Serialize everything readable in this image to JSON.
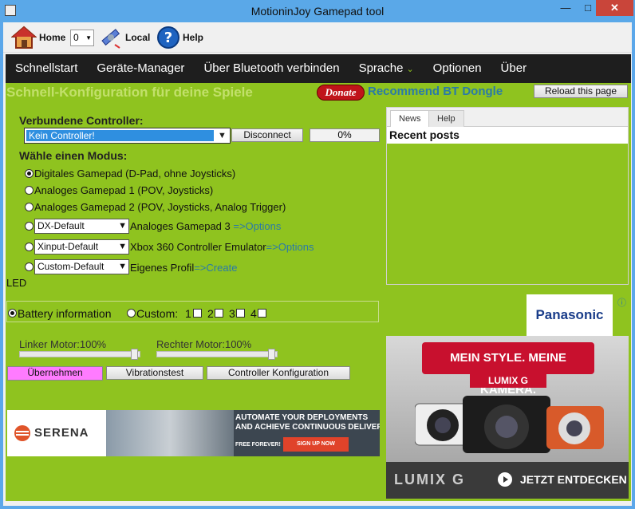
{
  "window": {
    "title": "MotioninJoy Gamepad tool",
    "minimize": "—",
    "maximize": "□",
    "close": "✕"
  },
  "toolbar": {
    "home": "Home",
    "combo_value": "0",
    "local": "Local",
    "help": "Help"
  },
  "menu": {
    "items": [
      "Schnellstart",
      "Geräte-Manager",
      "Über Bluetooth verbinden",
      "Sprache",
      "Optionen",
      "Über"
    ]
  },
  "header": {
    "title": "Schnell-Konfiguration für deine Spiele",
    "donate": "Donate",
    "recommend": "Recommend BT Dongle",
    "reload": "Reload this page"
  },
  "controllers": {
    "label": "Verbundene Controller:",
    "selected": "Kein Controller!",
    "disconnect": "Disconnect",
    "progress_text": "0%",
    "progress": 0
  },
  "modes": {
    "label": "Wähle einen Modus:",
    "digital": "Digitales Gamepad (D-Pad, ohne Joysticks)",
    "analog1": "Analoges Gamepad 1 (POV, Joysticks)",
    "analog2": "Analoges Gamepad 2 (POV, Joysticks, Analog Trigger)",
    "analog3_select": "DX-Default",
    "analog3": "Analoges Gamepad 3 ",
    "analog3_link": "=>Options",
    "xinput_select": "Xinput-Default",
    "xinput": "Xbox 360 Controller Emulator",
    "xinput_link": "=>Options",
    "custom_select": "Custom-Default",
    "custom": "Eigenes Profil",
    "custom_link": "=>Create"
  },
  "led": {
    "label": "LED",
    "battery": "Battery information",
    "custom": "Custom:",
    "c1": "1",
    "c2": "2",
    "c3": "3",
    "c4": "4"
  },
  "motors": {
    "left_label": "Linker Motor:100%",
    "right_label": "Rechter Motor:100%",
    "left": 1.0,
    "right": 1.0
  },
  "actions": {
    "apply": "Übernehmen",
    "vibration": "Vibrationstest",
    "config": "Controller Konfiguration"
  },
  "ad_banner": {
    "brand": "SERENA",
    "line1": "AUTOMATE YOUR DEPLOYMENTS",
    "line2": "AND ACHIEVE CONTINUOUS DELIVERY",
    "free": "FREE FOREVER!",
    "cta": "SIGN UP NOW"
  },
  "news": {
    "tab_news": "News",
    "tab_help": "Help",
    "recent": "Recent posts"
  },
  "right_ad": {
    "brand": "Panasonic",
    "headline": "MEIN STYLE. MEINE KAMERA.",
    "lumix": "LUMIX G",
    "bottom_brand": "LUMIX G",
    "cta": "JETZT ENTDECKEN",
    "info": "ⓘ"
  },
  "colors": {
    "content_bg": "#8fc31f",
    "menu_bg": "#1e1e1e",
    "apply_btn": "#ff7bff",
    "close_btn": "#c9453a"
  }
}
